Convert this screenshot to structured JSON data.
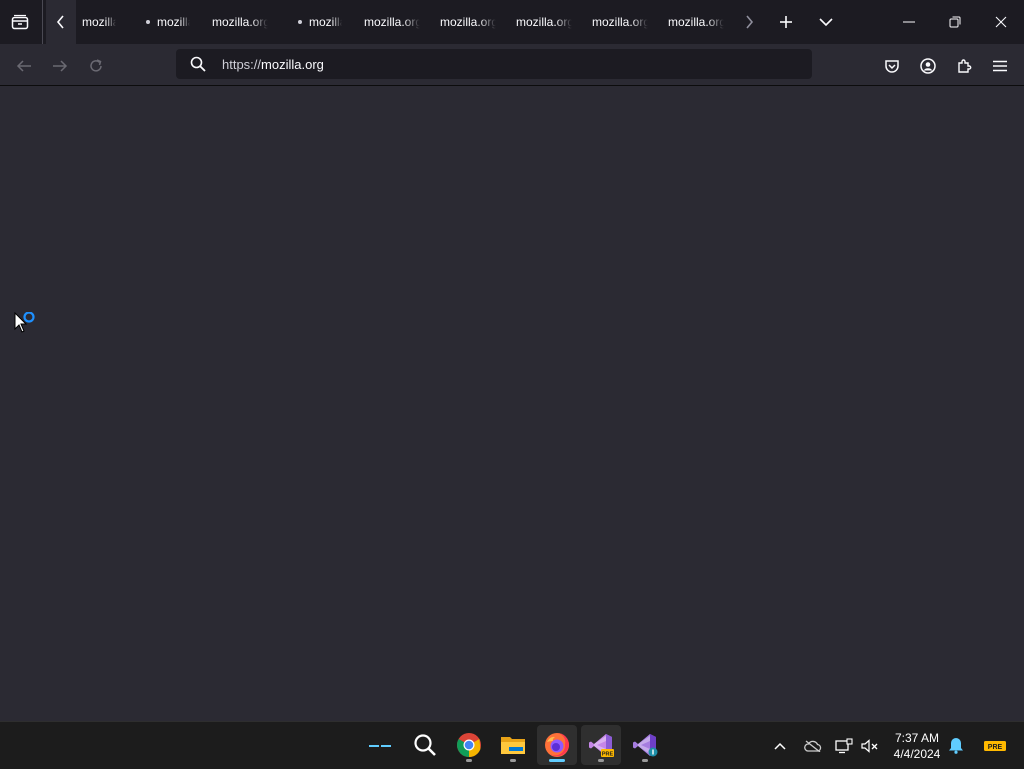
{
  "browser": {
    "tabs": [
      {
        "label": "mozilla.org",
        "dot": false
      },
      {
        "label": "mozilla.org",
        "dot": true
      },
      {
        "label": "mozilla.org",
        "dot": false
      },
      {
        "label": "mozilla.org",
        "dot": true
      },
      {
        "label": "mozilla.org",
        "dot": false
      },
      {
        "label": "mozilla.org",
        "dot": false
      },
      {
        "label": "mozilla.org",
        "dot": false
      },
      {
        "label": "mozilla.org",
        "dot": false
      },
      {
        "label": "mozilla.org",
        "dot": false
      }
    ],
    "url_protocol": "https://",
    "url_host": "mozilla.org"
  },
  "icons": {
    "tabstrip": [
      "firefox-view-icon",
      "scroll-tabs-left-icon",
      "scroll-tabs-right-icon",
      "new-tab-icon",
      "list-all-tabs-icon",
      "minimize-icon",
      "restore-icon",
      "close-icon"
    ],
    "navbar": [
      "back-icon",
      "forward-icon",
      "reload-icon",
      "search-icon",
      "pocket-icon",
      "account-icon",
      "extensions-icon",
      "app-menu-icon"
    ],
    "taskbar": [
      "widgets-icon",
      "search-icon",
      "chrome-icon",
      "file-explorer-icon",
      "firefox-icon",
      "visual-studio-preview-icon",
      "visual-studio-icon"
    ],
    "tray": [
      "show-hidden-icons-chevron",
      "onedrive-icon",
      "network-icon",
      "volume-muted-icon",
      "notification-bell-icon",
      "pre-badge-icon"
    ]
  },
  "taskbar": {
    "time": "7:37 AM",
    "date": "4/4/2024",
    "pre_badge": "PRE"
  },
  "colors": {
    "chrome_bg": "#1c1b22",
    "content_bg": "#2b2a33",
    "accent": "#60cdff"
  }
}
